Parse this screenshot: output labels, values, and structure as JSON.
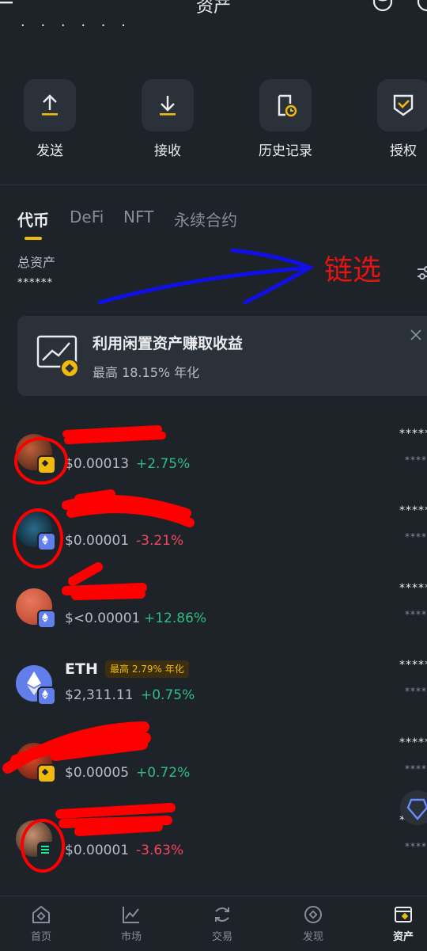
{
  "header": {
    "title": "资产",
    "balance_masked": "· · · · · ·"
  },
  "actions": [
    {
      "label": "发送",
      "icon": "send-icon"
    },
    {
      "label": "接收",
      "icon": "receive-icon"
    },
    {
      "label": "历史记录",
      "icon": "history-icon"
    },
    {
      "label": "授权",
      "icon": "authorize-icon"
    }
  ],
  "tabs": [
    {
      "label": "代币",
      "active": true
    },
    {
      "label": "DeFi",
      "active": false
    },
    {
      "label": "NFT",
      "active": false
    },
    {
      "label": "永续合约",
      "active": false
    }
  ],
  "total": {
    "label": "总资产",
    "value": "******"
  },
  "annotation": {
    "text": "链选"
  },
  "banner": {
    "title": "利用闲置资产赚取收益",
    "subtitle": "最高 18.15% 年化"
  },
  "tokens": [
    {
      "name": "",
      "price": "$0.00013",
      "change": "+2.75%",
      "direction": "up",
      "chain": "bnb",
      "balance": "*****",
      "value": "****"
    },
    {
      "name": "",
      "price": "$0.00001",
      "change": "-3.21%",
      "direction": "down",
      "chain": "eth",
      "balance": "*****",
      "value": "****"
    },
    {
      "name": "",
      "price": "$<0.00001",
      "change": "+12.86%",
      "direction": "up",
      "chain": "eth",
      "balance": "*****",
      "value": "****"
    },
    {
      "name": "ETH",
      "badge": "最高 2.79% 年化",
      "price": "$2,311.11",
      "change": "+0.75%",
      "direction": "up",
      "chain": "eth",
      "balance": "*****",
      "value": "****"
    },
    {
      "name": "",
      "price": "$0.00005",
      "change": "+0.72%",
      "direction": "up",
      "chain": "bnb",
      "balance": "*****",
      "value": "****"
    },
    {
      "name": "",
      "price": "$0.00001",
      "change": "-3.63%",
      "direction": "down",
      "chain": "sol",
      "balance": "*****",
      "value": "****"
    }
  ],
  "bottom_nav": [
    {
      "label": "首页",
      "icon": "home-icon",
      "active": false
    },
    {
      "label": "市场",
      "icon": "market-icon",
      "active": false
    },
    {
      "label": "交易",
      "icon": "trade-icon",
      "active": false
    },
    {
      "label": "发现",
      "icon": "discover-icon",
      "active": false
    },
    {
      "label": "资产",
      "icon": "assets-icon",
      "active": true
    }
  ],
  "colors": {
    "accent": "#f0b90b",
    "up": "#2ebd85",
    "down": "#f6465d",
    "annotation": "#e31414",
    "annotation_arrow": "#1010e6"
  }
}
